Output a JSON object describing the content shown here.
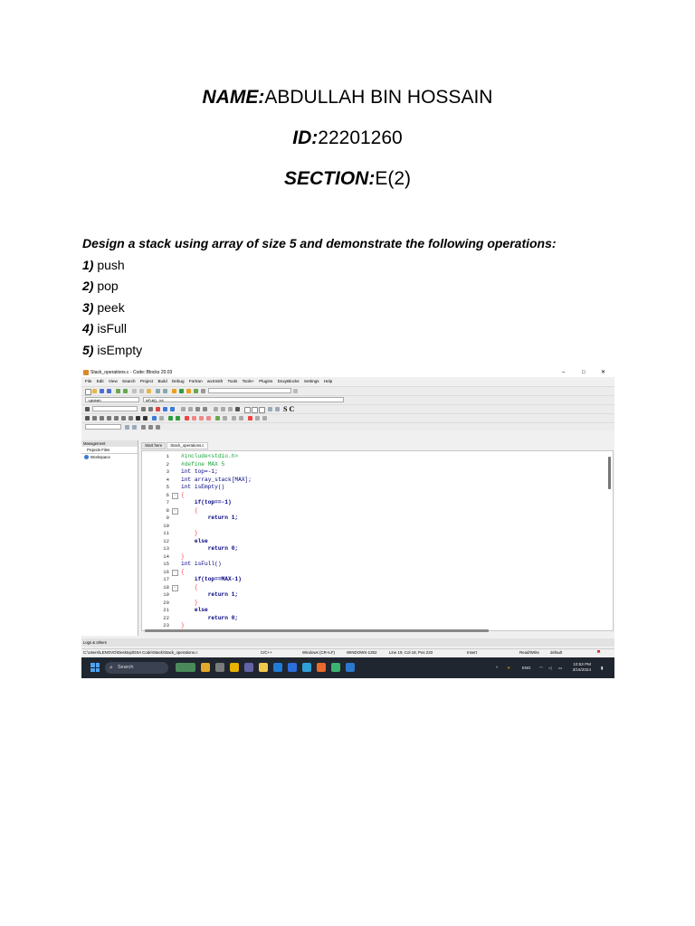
{
  "header": {
    "name_label": "NAME:",
    "name_value": "ABDULLAH BIN HOSSAIN",
    "id_label": "ID:",
    "id_value": "22201260",
    "section_label": "SECTION:",
    "section_value": "E(2)"
  },
  "task": {
    "question": "Design a stack using array of size 5 and demonstrate the following operations:",
    "items": [
      {
        "num": "1)",
        "text": "push"
      },
      {
        "num": "2)",
        "text": "pop"
      },
      {
        "num": "3)",
        "text": "peek"
      },
      {
        "num": "4)",
        "text": "isFull"
      },
      {
        "num": "5)",
        "text": "isEmpty"
      }
    ]
  },
  "ide": {
    "window_title": "Stack_operations.c - Code::Blocks 20.03",
    "window_controls": [
      "–",
      "□",
      "✕"
    ],
    "menu": [
      "File",
      "Edit",
      "View",
      "Search",
      "Project",
      "Build",
      "Debug",
      "Fortran",
      "wxSmith",
      "Tools",
      "Tools+",
      "Plugins",
      "DoxyBlocks",
      "Settings",
      "Help"
    ],
    "scope_combo": "<global>",
    "func_combo": "isFull() : int",
    "sc_label": "S C",
    "management": {
      "title": "Management",
      "tabs": "Projects   Files",
      "workspace": "Workspace"
    },
    "editor_tabs": [
      "Start here",
      "Stack_operations.c"
    ],
    "code_lines": [
      {
        "n": "1",
        "text": "#include<stdio.h>",
        "cls": "c-green"
      },
      {
        "n": "2",
        "text": "#define MAX 5",
        "cls": "c-green"
      },
      {
        "n": "3",
        "text": "int top=-1;",
        "cls": "c-norm"
      },
      {
        "n": "4",
        "text": "int array_stack[MAX];",
        "cls": "c-norm"
      },
      {
        "n": "5",
        "text": "int isEmpty()",
        "cls": "c-norm"
      },
      {
        "n": "6",
        "text": "{",
        "cls": "c-red"
      },
      {
        "n": "7",
        "text": "    if(top==-1)",
        "cls": "c-kw"
      },
      {
        "n": "8",
        "text": "    {",
        "cls": "c-red"
      },
      {
        "n": "9",
        "text": "        return 1;",
        "cls": "c-kw"
      },
      {
        "n": "10",
        "text": "",
        "cls": "c-norm"
      },
      {
        "n": "11",
        "text": "    }",
        "cls": "c-red"
      },
      {
        "n": "12",
        "text": "    else",
        "cls": "c-kw"
      },
      {
        "n": "13",
        "text": "        return 0;",
        "cls": "c-kw"
      },
      {
        "n": "14",
        "text": "}",
        "cls": "c-red"
      },
      {
        "n": "15",
        "text": "int isFull()",
        "cls": "c-norm"
      },
      {
        "n": "16",
        "text": "{",
        "cls": "c-red"
      },
      {
        "n": "17",
        "text": "    if(top==MAX-1)",
        "cls": "c-kw"
      },
      {
        "n": "18",
        "text": "    {",
        "cls": "c-red"
      },
      {
        "n": "19",
        "text": "        return 1;",
        "cls": "c-kw"
      },
      {
        "n": "20",
        "text": "    }",
        "cls": "c-red"
      },
      {
        "n": "21",
        "text": "    else",
        "cls": "c-kw"
      },
      {
        "n": "22",
        "text": "        return 0;",
        "cls": "c-kw"
      },
      {
        "n": "23",
        "text": "}",
        "cls": "c-red"
      }
    ],
    "logs_title": "Logs & others",
    "status": {
      "path": "C:\\Users\\LENOVO\\Desktop\\DSA Code\\Stack\\Stack_operations.c",
      "lang": "C/C++",
      "eol": "Windows (CR+LF)",
      "encoding": "WINDOWS-1252",
      "position": "Line 19, Col 18, Pos 233",
      "mode": "Insert",
      "access": "Read/Write",
      "profile": "default"
    },
    "taskbar": {
      "search_placeholder": "Search",
      "lang": "ENG",
      "time": "10:53 PM",
      "date": "3/15/2024"
    }
  }
}
